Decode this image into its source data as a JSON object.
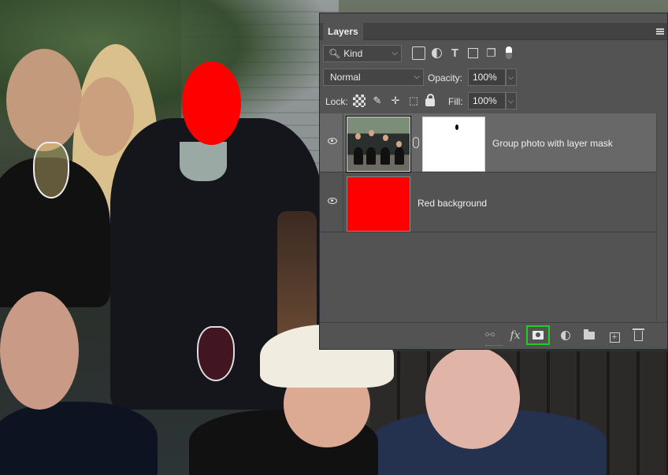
{
  "panel": {
    "tab_label": "Layers",
    "filter": {
      "kind_label": "Kind",
      "icons": [
        "pixel-filter-icon",
        "adjustment-filter-icon",
        "type-filter-icon",
        "shape-filter-icon",
        "smart-object-filter-icon",
        "filter-toggle-icon"
      ]
    },
    "blend_mode": "Normal",
    "opacity_label": "Opacity:",
    "opacity_value": "100%",
    "lock_label": "Lock:",
    "lock_icons": [
      "lock-transparency-icon",
      "lock-image-icon",
      "lock-position-icon",
      "lock-artboard-icon",
      "lock-all-icon"
    ],
    "fill_label": "Fill:",
    "fill_value": "100%",
    "layers": [
      {
        "name": "Group photo with layer mask",
        "visible": true,
        "selected": true,
        "has_mask": true
      },
      {
        "name": "Red background",
        "visible": true,
        "selected": false,
        "fill_color": "#ff0000"
      }
    ],
    "footer_icons": [
      "link-layers-icon",
      "fx-icon",
      "add-layer-mask-icon",
      "adjustment-layer-icon",
      "new-group-icon",
      "new-layer-icon",
      "delete-layer-icon"
    ],
    "highlight_color": "#22cc22"
  }
}
